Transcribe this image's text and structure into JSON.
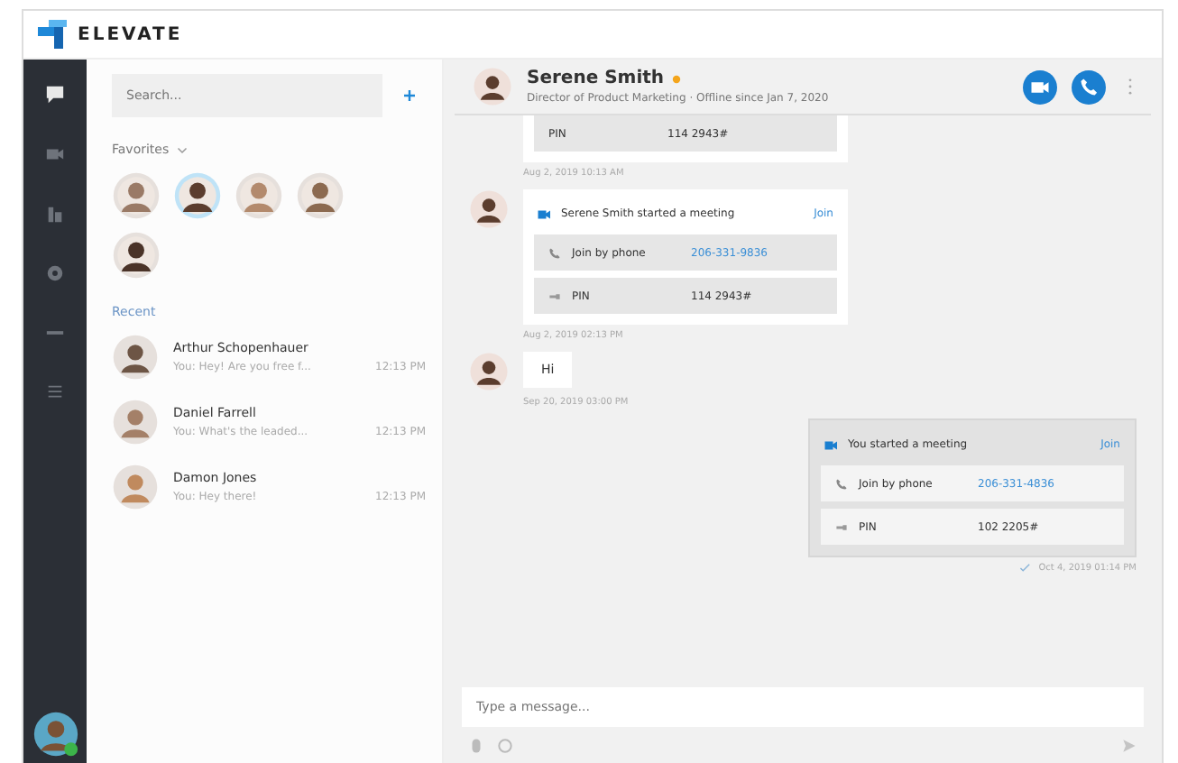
{
  "app": {
    "title": "ELEVATE"
  },
  "nav": [
    {
      "kind": "chat",
      "selected": true
    },
    {
      "kind": "video",
      "selected": false
    },
    {
      "kind": "calendar",
      "selected": false
    },
    {
      "kind": "gear",
      "selected": false
    },
    {
      "kind": "more",
      "selected": false
    },
    {
      "kind": "list",
      "selected": false
    }
  ],
  "search": {
    "placeholder": "Search..."
  },
  "favorites": {
    "label": "Favorites",
    "people": [
      {
        "selected": false,
        "color": "#9a7a66"
      },
      {
        "selected": true,
        "color": "#5b3d2e"
      },
      {
        "selected": false,
        "color": "#b38a6d"
      },
      {
        "selected": false,
        "color": "#8c6a50"
      },
      {
        "selected": false,
        "color": "#4a3328"
      }
    ]
  },
  "recent": {
    "label": "Recent",
    "conversations": [
      {
        "name": "Arthur Schopenhauer",
        "preview": "You: Hey! Are you free f...",
        "time": "12:13 PM",
        "color": "#6d5545"
      },
      {
        "name": "Daniel Farrell",
        "preview": "You: What's the leaded...",
        "time": "12:13 PM",
        "color": "#a48068"
      },
      {
        "name": "Damon Jones",
        "preview": "You: Hey there!",
        "time": "12:13 PM",
        "color": "#c08a5e"
      }
    ]
  },
  "contact": {
    "name": "Serene Smith",
    "favorite": true,
    "subtitle": "Director of Product Marketing · Offline since Jan 7, 2020"
  },
  "messages": [
    {
      "kind": "meeting-tail",
      "pin_label": "PIN",
      "pin": "114 2943#",
      "time": "Aug 2, 2019 10:13 AM"
    },
    {
      "kind": "meeting",
      "mine": false,
      "title": "Serene Smith started a meeting",
      "join": "Join",
      "phone_label": "Join by phone",
      "phone": "206-331-9836",
      "pin_label": "PIN",
      "pin": "114 2943#",
      "time": "Aug 2, 2019 02:13 PM"
    },
    {
      "kind": "text",
      "mine": false,
      "text": "Hi",
      "time": "Sep 20, 2019 03:00 PM"
    },
    {
      "kind": "meeting",
      "mine": true,
      "title": "You started a meeting",
      "join": "Join",
      "phone_label": "Join by phone",
      "phone": "206-331-4836",
      "pin_label": "PIN",
      "pin": "102 2205#",
      "time": "Oct 4, 2019 01:14 PM"
    }
  ],
  "composer": {
    "placeholder": "Type a message..."
  }
}
